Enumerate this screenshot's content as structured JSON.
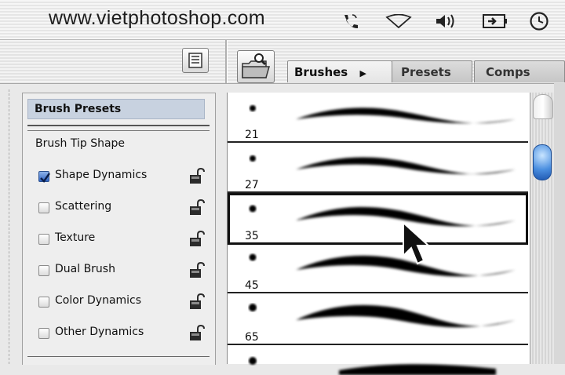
{
  "menubar": {
    "site_title": "www.vietphotoshop.com",
    "icons": [
      "phone-icon",
      "wifi-icon",
      "volume-icon",
      "battery-icon",
      "clock-icon"
    ]
  },
  "toolbar": {
    "tabs": [
      {
        "label": "Brushes"
      },
      {
        "label": "Presets"
      },
      {
        "label": "Comps"
      }
    ]
  },
  "options_panel": {
    "header": "Brush Presets",
    "tip_shape": "Brush Tip Shape",
    "options": [
      {
        "label": "Shape Dynamics",
        "checked": true
      },
      {
        "label": "Scattering",
        "checked": false
      },
      {
        "label": "Texture",
        "checked": false
      },
      {
        "label": "Dual Brush",
        "checked": false
      },
      {
        "label": "Color Dynamics",
        "checked": false
      },
      {
        "label": "Other Dynamics",
        "checked": false
      }
    ]
  },
  "brush_list": {
    "items": [
      {
        "size": "21"
      },
      {
        "size": "27"
      },
      {
        "size": "35",
        "selected": true
      },
      {
        "size": "45"
      },
      {
        "size": "65"
      },
      {
        "size": ""
      }
    ]
  },
  "colors": {
    "selection_header": "#c8d2e0",
    "scroll_thumb": "#4b8fe0",
    "checkbox_checked": "#3266c4"
  }
}
